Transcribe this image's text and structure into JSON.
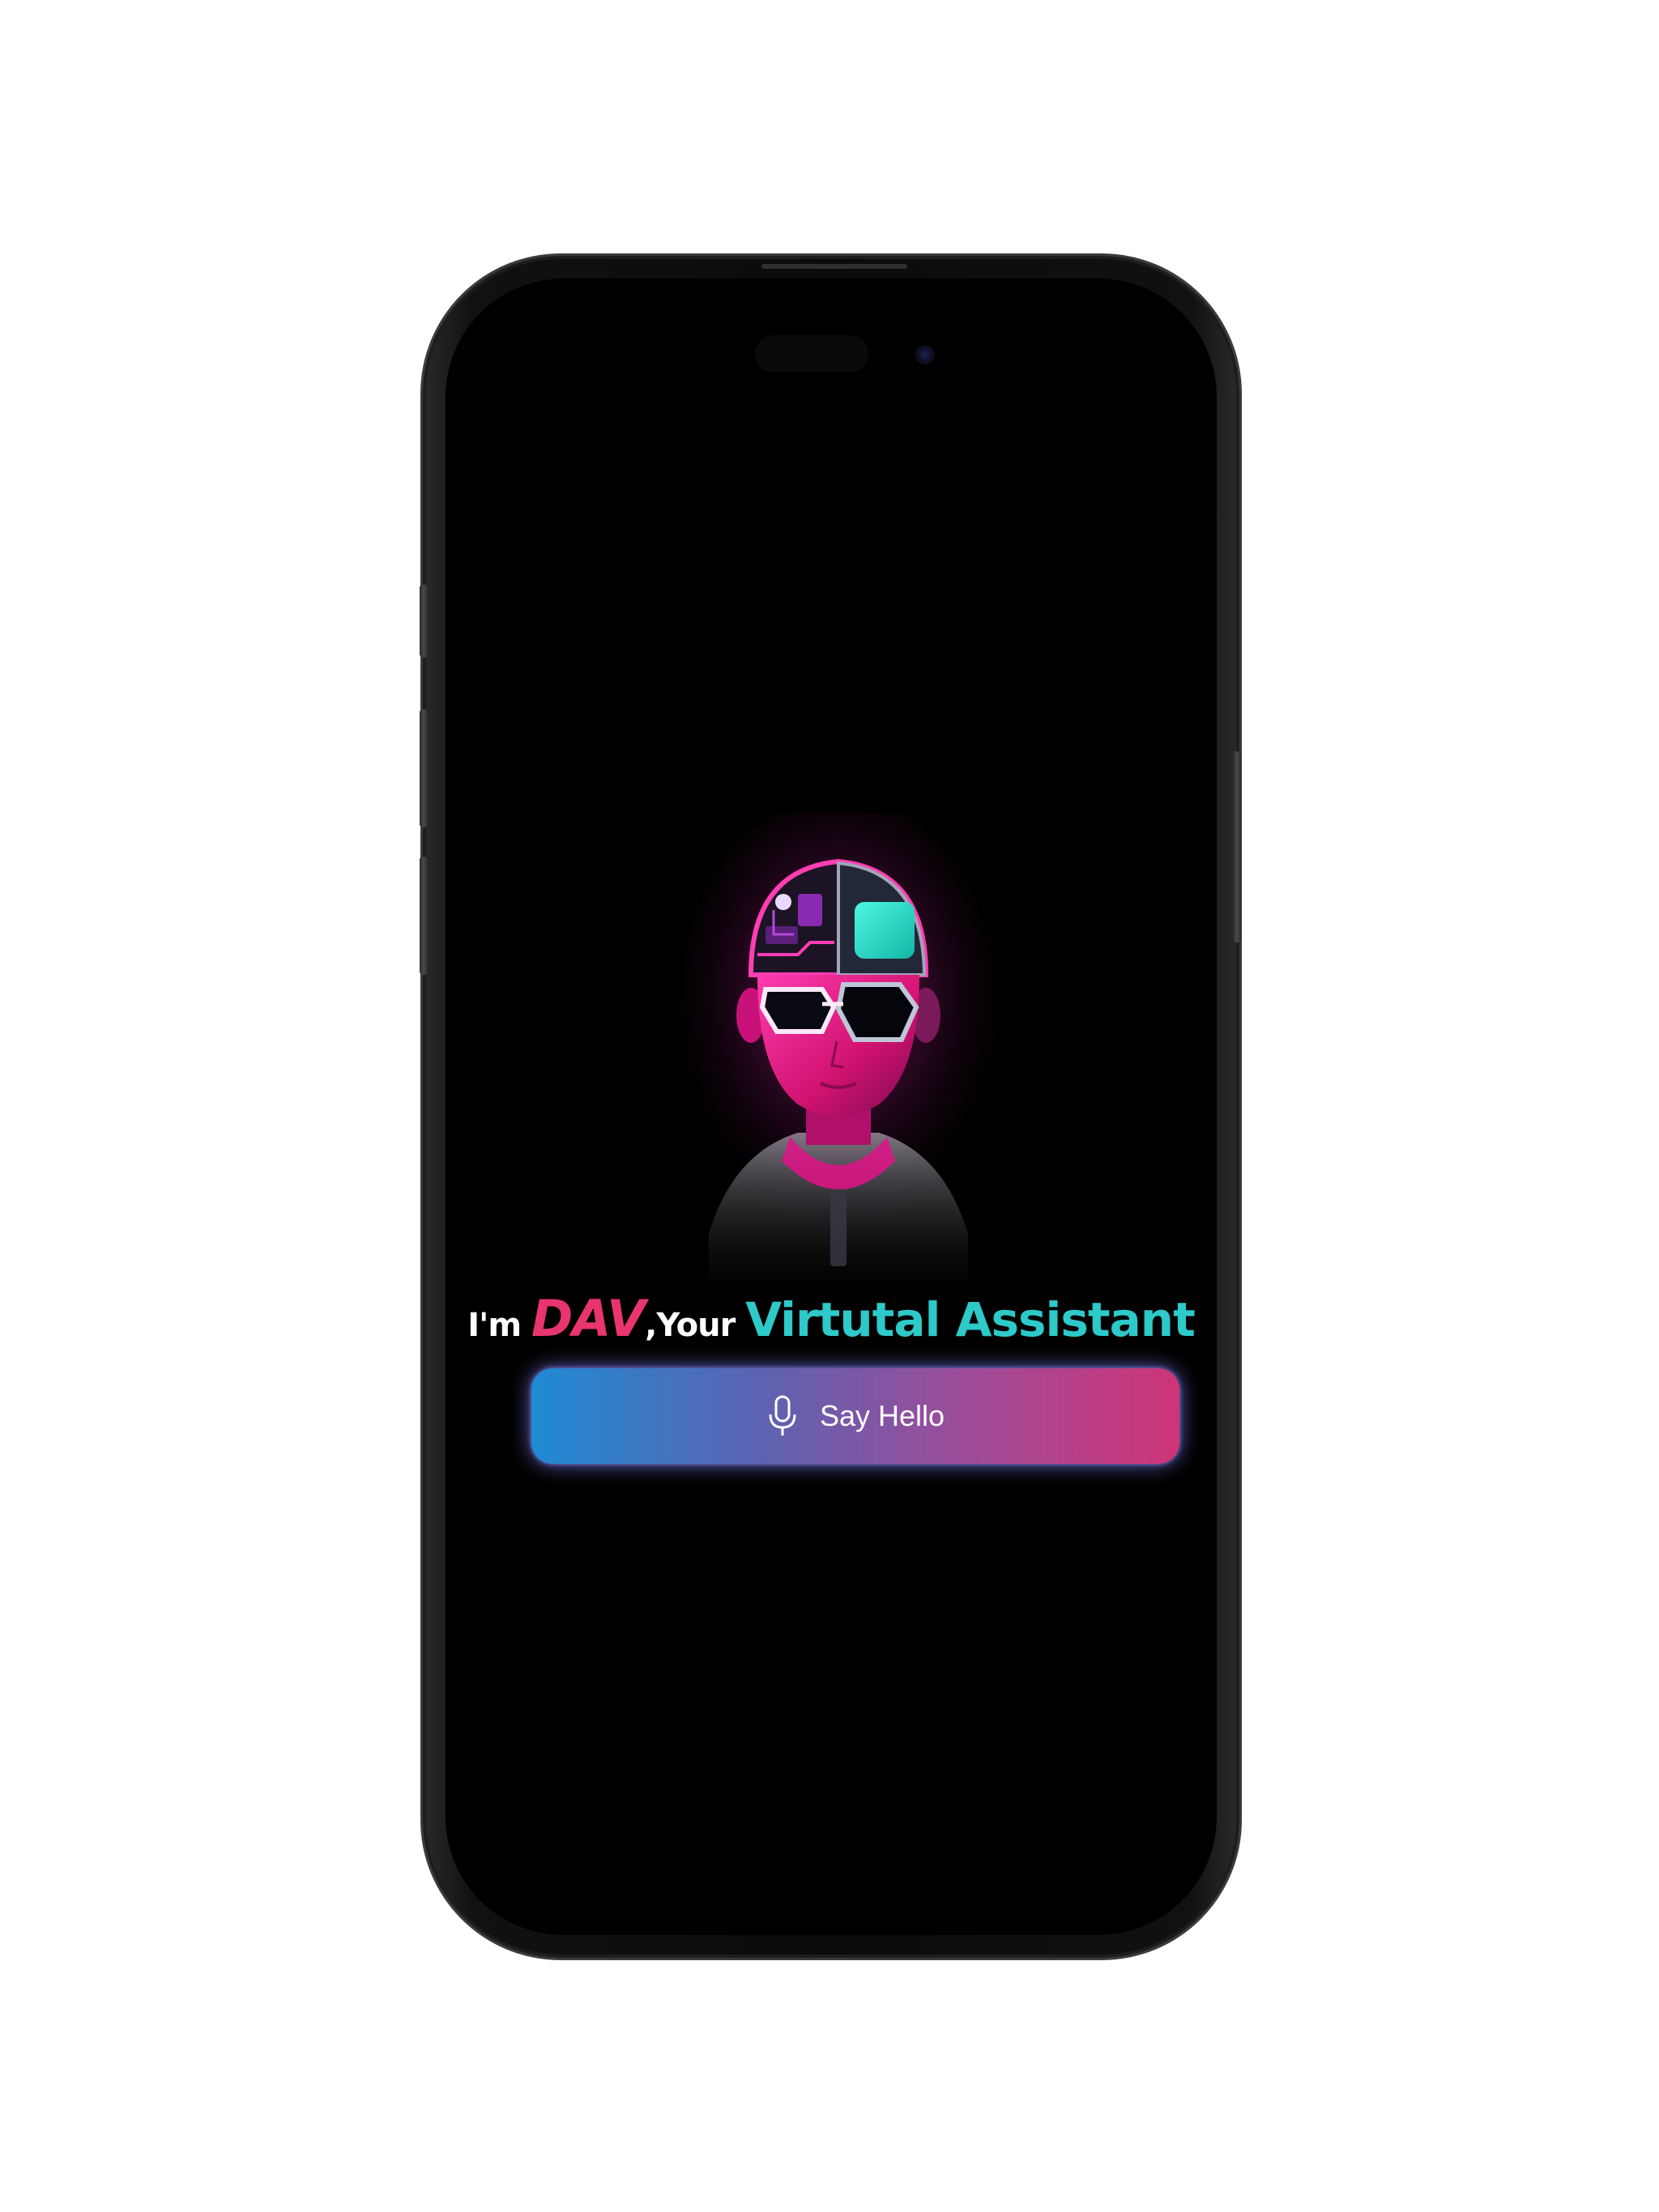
{
  "headline": {
    "prefix": "I'm ",
    "name": "DAV",
    "middle": ",Your ",
    "role": "Virtutal Assistant"
  },
  "say_hello_button": {
    "label": "Say Hello",
    "icon": "microphone-icon"
  },
  "avatar": {
    "icon": "cyberpunk-avatar-illustration"
  },
  "colors": {
    "screen_background": "#000000",
    "accent_pink": "#e8356f",
    "accent_cyan": "#2ec9c9",
    "button_gradient_start": "#1f8bd3",
    "button_gradient_end": "#cf3477"
  }
}
